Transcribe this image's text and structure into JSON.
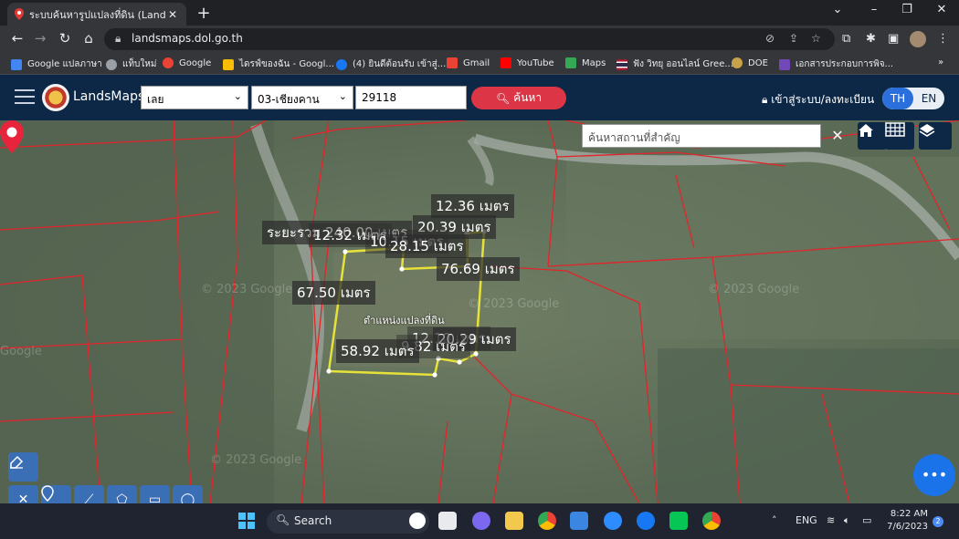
{
  "browser": {
    "tab_title": "ระบบค้นหารูปแปลงที่ดิน (LandsMaps",
    "tab_close": "✕",
    "new_tab": "+",
    "url": "landsmaps.dol.go.th",
    "window_controls": [
      "⌄",
      "–",
      "❐",
      "✕"
    ]
  },
  "bookmarks": [
    {
      "label": "Google แปลภาษา",
      "icon": "translate-icon",
      "color": "#4285f4"
    },
    {
      "label": "แท็บใหม่",
      "icon": "globe-icon",
      "color": "#9aa0a6"
    },
    {
      "label": "Google",
      "icon": "google-icon",
      "color": "#ea4335"
    },
    {
      "label": "ไดรฟ์ของฉัน - Googl...",
      "icon": "drive-icon",
      "color": "#fbbc04"
    },
    {
      "label": "(4) ยินดีต้อนรับ เข้าสู่...",
      "icon": "facebook-icon",
      "color": "#1877f2"
    },
    {
      "label": "Gmail",
      "icon": "gmail-icon",
      "color": "#ea4335"
    },
    {
      "label": "YouTube",
      "icon": "youtube-icon",
      "color": "#ff0000"
    },
    {
      "label": "Maps",
      "icon": "maps-icon",
      "color": "#34a853"
    },
    {
      "label": "ฟัง วิทยุ ออนไลน์ Gree...",
      "icon": "flag-icon",
      "color": "#a51931"
    },
    {
      "label": "DOE",
      "icon": "doe-icon",
      "color": "#c8a24a"
    },
    {
      "label": "เอกสารประกอบการพิจ...",
      "icon": "forms-icon",
      "color": "#7248b9"
    }
  ],
  "bookmarks_more": "»",
  "header": {
    "brand": "LandsMaps",
    "province": "เลย",
    "district": "03-เชียงคาน",
    "parcel_no": "29118",
    "search_label": "ค้นหา",
    "login_label": "เข้าสู่ระบบ/ลงทะเบียน",
    "lang_th": "TH",
    "lang_en": "EN"
  },
  "map": {
    "place_search_placeholder": "ค้นหาสถานที่สำคัญ",
    "clear": "✕",
    "pin_caption": "ตำแหน่งแปลงที่ดิน",
    "watermark": "© 2023 Google",
    "watermark_short": "Google",
    "labels": [
      "12.36 เมตร",
      "20.39 เมตร",
      "ระยะรวม 240.00 เมตร",
      "12.32 เมตร",
      "10.15 เมตร",
      "28.15 เมตร",
      "76.69 เมตร",
      "67.50 เมตร",
      "12.10 เมตร",
      "20.29 เมตร",
      "9.82 เมตร",
      "58.92 เมตร"
    ],
    "fab": "•••"
  },
  "taskbar": {
    "search_label": "Search",
    "lang": "ENG",
    "time": "8:22 AM",
    "date": "7/6/2023",
    "notifications": "2"
  }
}
